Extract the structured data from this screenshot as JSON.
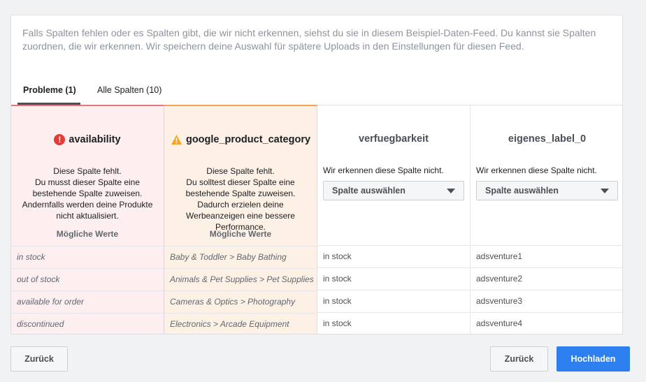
{
  "intro_text": "Falls Spalten fehlen oder es Spalten gibt, die wir nicht erkennen, siehst du sie in diesem Beispiel-Daten-Feed. Du kannst sie Spalten zuordnen, die wir erkennen. Wir speichern deine Auswahl für spätere Uploads in den Einstellungen für diesen Feed.",
  "tabs": [
    {
      "label": "Probleme (1)",
      "active": true
    },
    {
      "label": "Alle Spalten (10)",
      "active": false
    }
  ],
  "columns": [
    {
      "name": "availability",
      "status": "error",
      "icon": "error-icon",
      "accent": "#e07a7a",
      "description": "Diese Spalte fehlt.\nDu musst dieser Spalte eine bestehende Spalte zuweisen. Andernfalls werden deine Produkte nicht aktualisiert.",
      "possible_values_label": "Mögliche Werte",
      "rows": [
        "in stock",
        "out of stock",
        "available for order",
        "discontinued"
      ]
    },
    {
      "name": "google_product_category",
      "status": "warning",
      "icon": "warning-icon",
      "accent": "#f1a54f",
      "description": "Diese Spalte fehlt.\nDu solltest dieser Spalte eine bestehende Spalte zuweisen. Dadurch erzielen deine Werbeanzeigen eine bessere Performance.",
      "possible_values_label": "Mögliche Werte",
      "rows": [
        "Baby & Toddler > Baby Bathing",
        "Animals & Pet Supplies > Pet Supplies",
        "Cameras & Optics > Photography",
        "Electronics > Arcade Equipment"
      ]
    },
    {
      "name": "verfuegbarkeit",
      "status": "unrecognized",
      "description": "Wir erkennen diese Spalte nicht.",
      "select_label": "Spalte auswählen",
      "rows": [
        "in stock",
        "in stock",
        "in stock",
        "in stock"
      ]
    },
    {
      "name": "eigenes_label_0",
      "status": "unrecognized",
      "description": "Wir erkennen diese Spalte nicht.",
      "select_label": "Spalte auswählen",
      "rows": [
        "adsventure1",
        "adsventure2",
        "adsventure3",
        "adsventure4"
      ]
    }
  ],
  "footer": {
    "back_left": "Zurück",
    "back_right": "Zurück",
    "upload": "Hochladen"
  },
  "colors": {
    "primary": "#2d7ff0",
    "error": "#e03c3c",
    "warning": "#f5a623"
  }
}
